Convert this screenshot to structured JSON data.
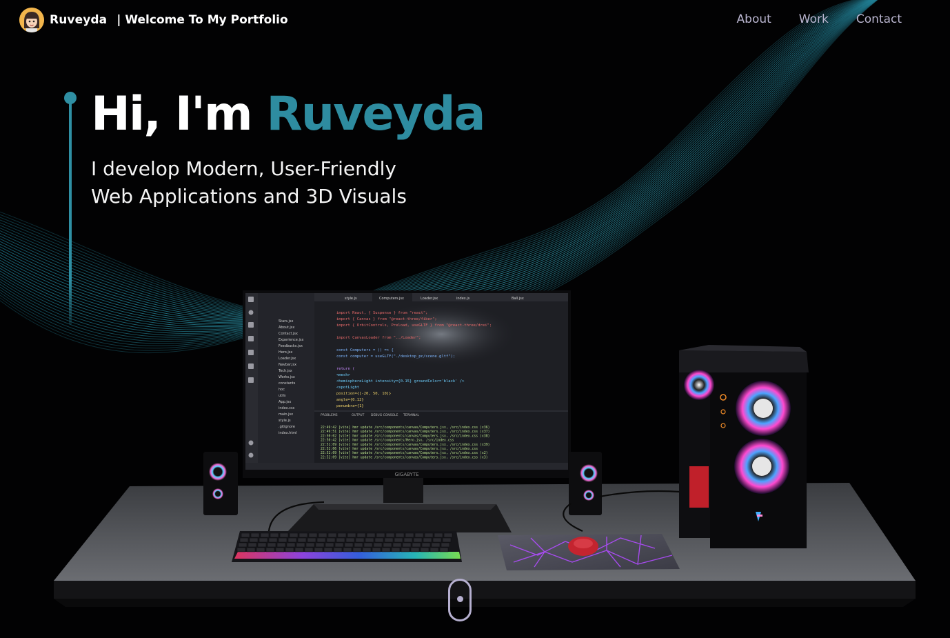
{
  "brand": {
    "name": "Ruveyda",
    "tagline": "| Welcome To My Portfolio"
  },
  "nav": {
    "items": [
      {
        "label": "About"
      },
      {
        "label": "Work"
      },
      {
        "label": "Contact"
      }
    ]
  },
  "hero": {
    "greeting": "Hi, I'm ",
    "name": "Ruveyda",
    "subtitle_line1": "I develop Modern, User-Friendly",
    "subtitle_line2": "Web Applications and 3D Visuals"
  },
  "scene": {
    "monitor_brand": "GIGABYTE",
    "editor_tabs": [
      "style.js",
      "Computers.jsx",
      "Loader.jsx",
      "index.js",
      "Ball.jsx"
    ],
    "code_lines": [
      "import React, { Suspense } from \"react\";",
      "import { Canvas } from \"@react-three/fiber\";",
      "import { OrbitControls, Preload, useGLTF } from \"@react-three/drei\";",
      "",
      "import CanvasLoader from \"../Loader\";",
      "",
      "const Computers = () => {",
      "  const computer = useGLTF(\"./desktop_pc/scene.gltf\");",
      "",
      "  return (",
      "    <mesh>",
      "      <hemisphereLight intensity={0.15} groundColor='black' />",
      "      <spotLight",
      "        position={[-20, 50, 10]}",
      "        angle={0.12}",
      "        penumbra={1}"
    ],
    "terminal_lines": [
      "22:49:42 [vite] hmr update /src/components/canvas/Computers.jsx, /src/index.css (x36)",
      "22:49:51 [vite] hmr update /src/components/canvas/Computers.jsx, /src/index.css (x37)",
      "22:50:02 [vite] hmr update /src/components/canvas/Computers.jsx, /src/index.css (x38)",
      "22:50:42 [vite] hmr update /src/components/Hero.jsx, /src/index.css",
      "22:51:09 [vite] hmr update /src/components/canvas/Computers.jsx, /src/index.css (x39)",
      "22:52:06 [vite] hmr update /src/components/canvas/Computers.jsx, /src/index.css",
      "22:52:09 [vite] hmr update /src/components/canvas/Computers.jsx, /src/index.css (x2)",
      "22:52:09 [vite] hmr update /src/components/canvas/Computers.jsx, /src/index.css (x3)"
    ],
    "panel_tabs": [
      "PROBLEMS",
      "OUTPUT",
      "DEBUG CONSOLE",
      "TERMINAL"
    ],
    "explorer_files": [
      "Stars.jsx",
      "About.jsx",
      "Contact.jsx",
      "Experience.jsx",
      "Feedbacks.jsx",
      "Hero.jsx",
      "Loader.jsx",
      "Navbar.jsx",
      "Tech.jsx",
      "Works.jsx",
      "constants",
      "hoc",
      "utils",
      "App.jsx",
      "index.css",
      "main.jsx",
      "style.js",
      ".gitignore",
      "index.html"
    ]
  },
  "colors": {
    "accent": "#2e8ca0",
    "nav_text": "#b9b5cf",
    "wave": "#2a9fb2"
  }
}
